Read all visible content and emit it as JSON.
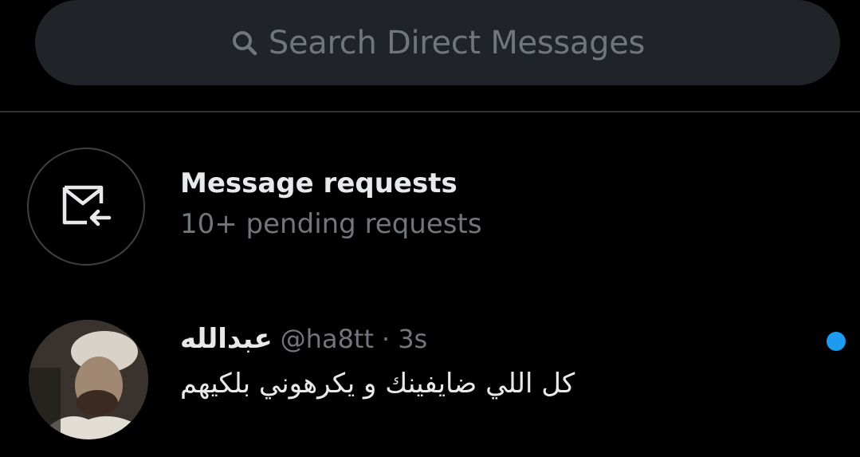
{
  "search": {
    "placeholder": "Search Direct Messages"
  },
  "requests": {
    "title": "Message requests",
    "subtitle": "10+ pending requests"
  },
  "conversation": {
    "name": "عبدالله",
    "handle": "@ha8tt",
    "separator": "·",
    "time": "3s",
    "preview": "كل اللي ضايفينك و يكرهوني بلكيهم",
    "unread": true
  },
  "colors": {
    "background": "#000000",
    "search_bg": "#202327",
    "muted_text": "#71767b",
    "primary_text": "#e7e9ea",
    "accent": "#1d9bf0"
  },
  "icons": {
    "search": "search-icon",
    "requests": "envelope-arrow-icon"
  }
}
